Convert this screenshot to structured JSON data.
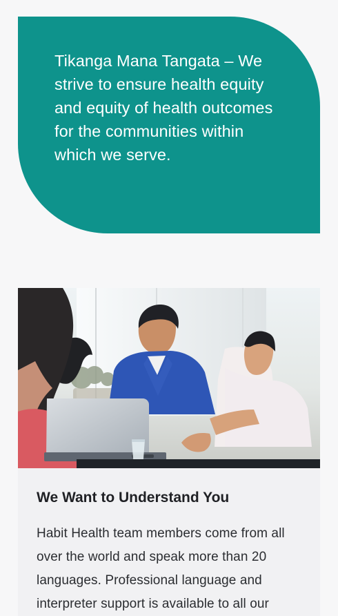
{
  "quote": {
    "text": "Tikanga Mana Tangata – We strive to ensure health equity and equity of health outcomes for the communities within which we serve."
  },
  "feature": {
    "title": "We Want to Understand You",
    "body": "Habit Health team members come from all over the world and speak more than 20 languages. Professional language and interpreter support is available to all our"
  },
  "colors": {
    "accent": "#0e938c",
    "background": "#f7f7f8",
    "card": "#f1f1f3"
  }
}
